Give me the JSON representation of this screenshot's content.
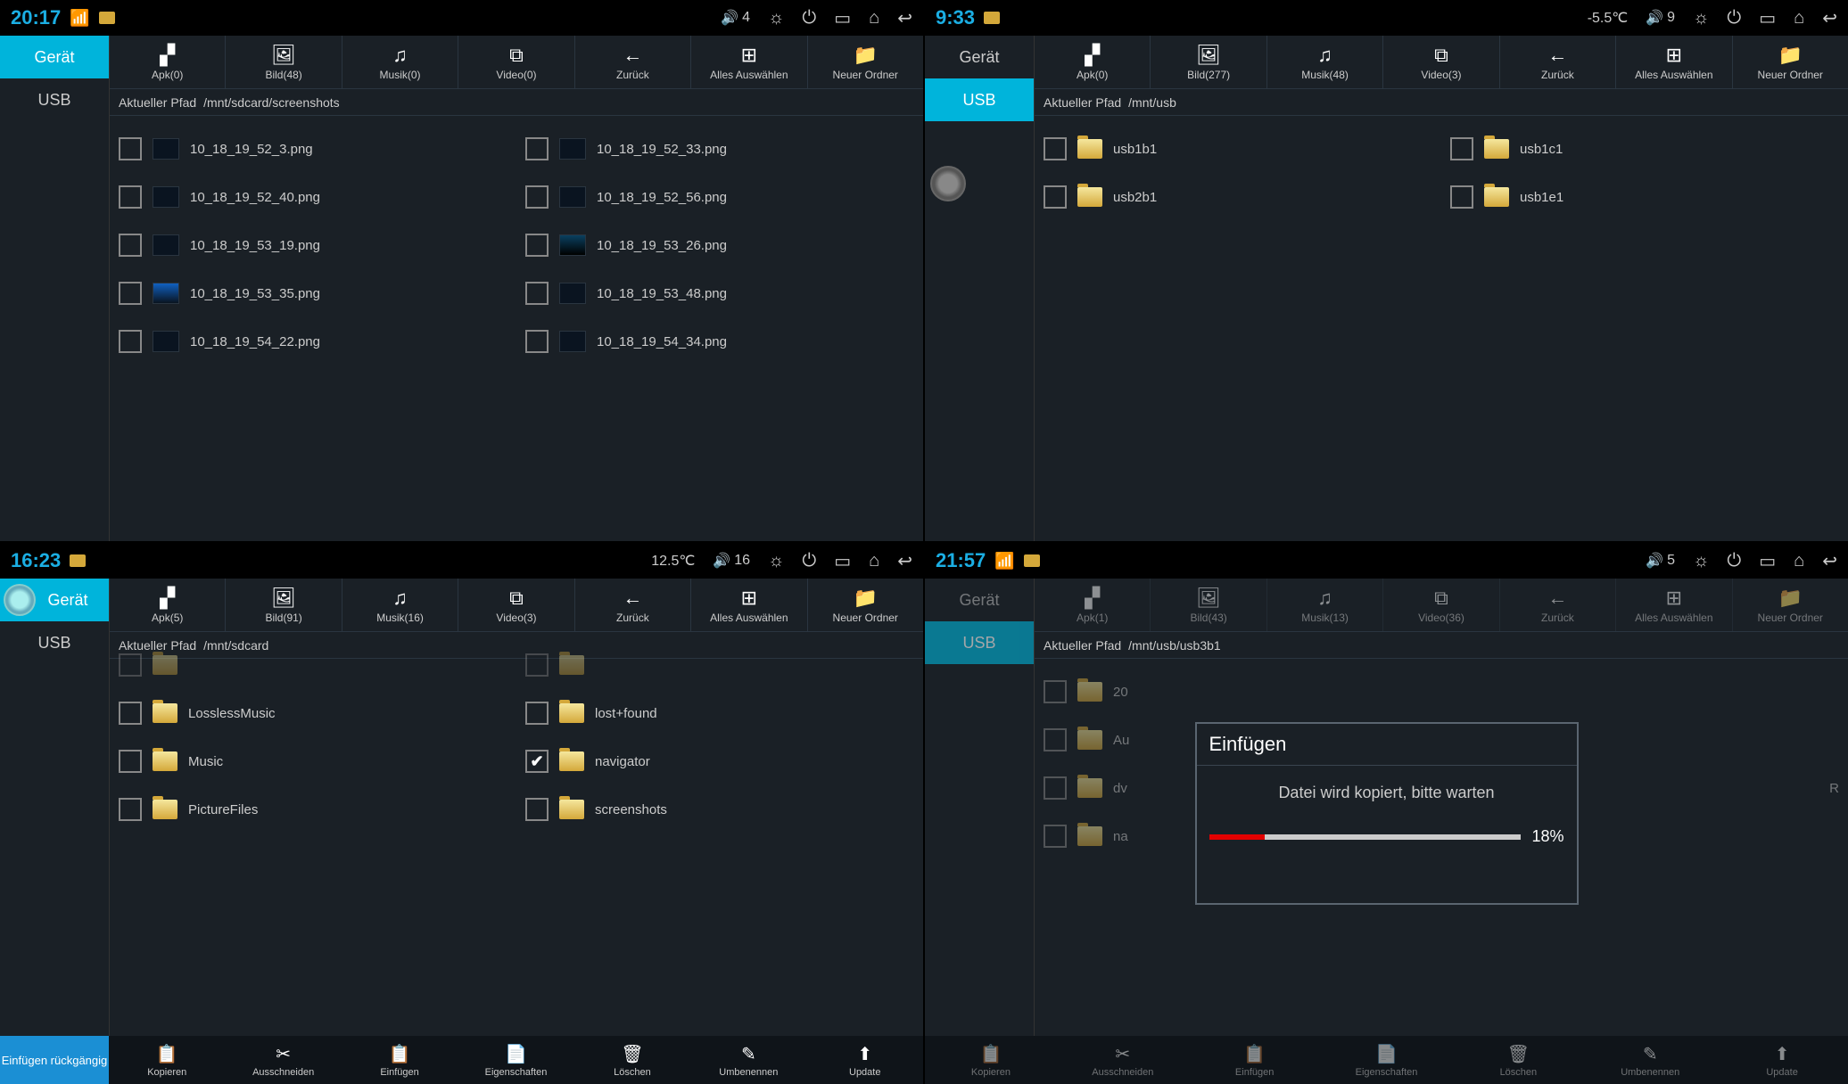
{
  "panes": [
    {
      "status": {
        "time": "20:17",
        "wifi": true,
        "vol": "4",
        "temp": null
      },
      "sidebar": {
        "active": "geraet",
        "items": [
          "Gerät",
          "USB"
        ]
      },
      "toolbar": [
        {
          "l": "Apk(0)"
        },
        {
          "l": "Bild(48)"
        },
        {
          "l": "Musik(0)"
        },
        {
          "l": "Video(0)"
        },
        {
          "l": "Zurück"
        },
        {
          "l": "Alles Auswählen"
        },
        {
          "l": "Neuer Ordner"
        }
      ],
      "path_label": "Aktueller Pfad",
      "path": "/mnt/sdcard/screenshots",
      "files": [
        {
          "n": "10_18_19_52_3.png",
          "t": "thumb"
        },
        {
          "n": "10_18_19_52_33.png",
          "t": "thumb"
        },
        {
          "n": "10_18_19_52_40.png",
          "t": "thumb"
        },
        {
          "n": "10_18_19_52_56.png",
          "t": "thumb"
        },
        {
          "n": "10_18_19_53_19.png",
          "t": "thumb"
        },
        {
          "n": "10_18_19_53_26.png",
          "t": "thumb cyan"
        },
        {
          "n": "10_18_19_53_35.png",
          "t": "thumb blue"
        },
        {
          "n": "10_18_19_53_48.png",
          "t": "thumb"
        },
        {
          "n": "10_18_19_54_22.png",
          "t": "thumb"
        },
        {
          "n": "10_18_19_54_34.png",
          "t": "thumb"
        }
      ]
    },
    {
      "status": {
        "time": "9:33",
        "wifi": false,
        "vol": "9",
        "temp": "-5.5℃"
      },
      "sidebar": {
        "active": "usb",
        "items": [
          "Gerät",
          "USB"
        ]
      },
      "toolbar": [
        {
          "l": "Apk(0)"
        },
        {
          "l": "Bild(277)"
        },
        {
          "l": "Musik(48)"
        },
        {
          "l": "Video(3)"
        },
        {
          "l": "Zurück"
        },
        {
          "l": "Alles Auswählen"
        },
        {
          "l": "Neuer Ordner"
        }
      ],
      "path_label": "Aktueller Pfad",
      "path": "/mnt/usb",
      "files": [
        {
          "n": "usb1b1",
          "t": "folder"
        },
        {
          "n": "usb1c1",
          "t": "folder"
        },
        {
          "n": "usb2b1",
          "t": "folder"
        },
        {
          "n": "usb1e1",
          "t": "folder"
        }
      ],
      "assist": true
    },
    {
      "status": {
        "time": "16:23",
        "wifi": false,
        "vol": "16",
        "temp": "12.5℃"
      },
      "sidebar": {
        "active": "geraet",
        "items": [
          "Gerät",
          "USB"
        ]
      },
      "toolbar": [
        {
          "l": "Apk(5)"
        },
        {
          "l": "Bild(91)"
        },
        {
          "l": "Musik(16)"
        },
        {
          "l": "Video(3)"
        },
        {
          "l": "Zurück"
        },
        {
          "l": "Alles Auswählen"
        },
        {
          "l": "Neuer Ordner"
        }
      ],
      "path_label": "Aktueller Pfad",
      "path": "/mnt/sdcard",
      "files_partial_top": true,
      "files": [
        {
          "n": "",
          "t": "folder",
          "partial": true
        },
        {
          "n": "",
          "t": "folder",
          "partial": true
        },
        {
          "n": "LosslessMusic",
          "t": "folder"
        },
        {
          "n": "lost+found",
          "t": "folder"
        },
        {
          "n": "Music",
          "t": "folder"
        },
        {
          "n": "navigator",
          "t": "folder",
          "checked": true
        },
        {
          "n": "PictureFiles",
          "t": "folder"
        },
        {
          "n": "screenshots",
          "t": "folder"
        }
      ],
      "bottom": {
        "undo": "Einfügen rückgängig",
        "btns": [
          "Kopieren",
          "Ausschneiden",
          "Einfügen",
          "Eigenschaften",
          "Löschen",
          "Umbenennen",
          "Update"
        ]
      },
      "assist_tl": true
    },
    {
      "status": {
        "time": "21:57",
        "wifi": true,
        "vol": "5",
        "temp": null
      },
      "sidebar": {
        "active": "usb",
        "items": [
          "Gerät",
          "USB"
        ]
      },
      "toolbar": [
        {
          "l": "Apk(1)"
        },
        {
          "l": "Bild(43)"
        },
        {
          "l": "Musik(13)"
        },
        {
          "l": "Video(36)"
        },
        {
          "l": "Zurück"
        },
        {
          "l": "Alles Auswählen"
        },
        {
          "l": "Neuer Ordner"
        }
      ],
      "path_label": "Aktueller Pfad",
      "path": "/mnt/usb/usb3b1",
      "files": [
        {
          "n": "20",
          "t": "folder"
        },
        {
          "n": "",
          "t": "none"
        },
        {
          "n": "Au",
          "t": "folder"
        },
        {
          "n": "",
          "t": "none"
        },
        {
          "n": "dv",
          "t": "folder"
        },
        {
          "n": "R",
          "t": "none",
          "right": true
        },
        {
          "n": "na",
          "t": "folder"
        },
        {
          "n": "",
          "t": "none"
        }
      ],
      "dimmed": true,
      "bottom": {
        "btns": [
          "Kopieren",
          "Ausschneiden",
          "Einfügen",
          "Eigenschaften",
          "Löschen",
          "Umbenennen",
          "Update"
        ]
      },
      "dialog": {
        "title": "Einfügen",
        "msg": "Datei wird kopiert, bitte warten",
        "pct": "18%",
        "fill": 18
      }
    }
  ],
  "tool_icons": [
    "▞",
    "🖼",
    "♫",
    "⧉",
    "←",
    "⊞",
    "📁"
  ],
  "btm_icons": [
    "📋",
    "✂",
    "📋",
    "📄",
    "🗑",
    "✎",
    "⬆"
  ],
  "sys_icons": [
    "☼",
    "⏻",
    "▭",
    "⌂",
    "↩"
  ]
}
